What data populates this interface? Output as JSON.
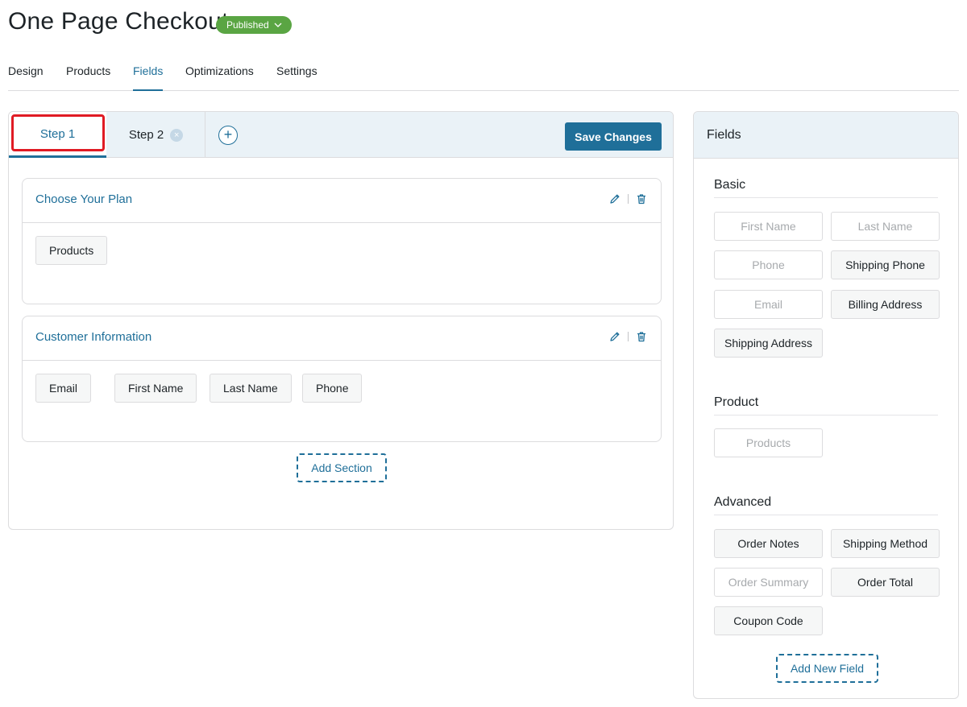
{
  "page": {
    "title": "One Page Checkout",
    "status": "Published"
  },
  "nav_tabs": [
    {
      "label": "Design"
    },
    {
      "label": "Products"
    },
    {
      "label": "Fields"
    },
    {
      "label": "Optimizations"
    },
    {
      "label": "Settings"
    }
  ],
  "steps": {
    "step1": "Step 1",
    "step2": "Step 2",
    "add_step_symbol": "+",
    "close_symbol": "×",
    "save_label": "Save Changes"
  },
  "sections": [
    {
      "title": "Choose Your Plan",
      "fields": [
        "Products"
      ]
    },
    {
      "title": "Customer Information",
      "fields": [
        "Email",
        "First Name",
        "Last Name",
        "Phone"
      ]
    }
  ],
  "add_section_label": "Add Section",
  "fields_panel": {
    "title": "Fields",
    "groups": [
      {
        "title": "Basic",
        "fields": [
          {
            "label": "First Name",
            "state": "disabled"
          },
          {
            "label": "Last Name",
            "state": "disabled"
          },
          {
            "label": "Phone",
            "state": "disabled"
          },
          {
            "label": "Shipping Phone",
            "state": "active"
          },
          {
            "label": "Email",
            "state": "disabled"
          },
          {
            "label": "Billing Address",
            "state": "active"
          },
          {
            "label": "Shipping Address",
            "state": "active"
          }
        ]
      },
      {
        "title": "Product",
        "fields": [
          {
            "label": "Products",
            "state": "disabled"
          }
        ]
      },
      {
        "title": "Advanced",
        "fields": [
          {
            "label": "Order Notes",
            "state": "active"
          },
          {
            "label": "Shipping Method",
            "state": "active"
          },
          {
            "label": "Order Summary",
            "state": "disabled"
          },
          {
            "label": "Order Total",
            "state": "active"
          },
          {
            "label": "Coupon Code",
            "state": "active"
          }
        ]
      }
    ],
    "add_field_label": "Add New Field"
  },
  "colors": {
    "accent": "#1f6f99",
    "published": "#5aa543",
    "highlight": "#e01b24"
  }
}
